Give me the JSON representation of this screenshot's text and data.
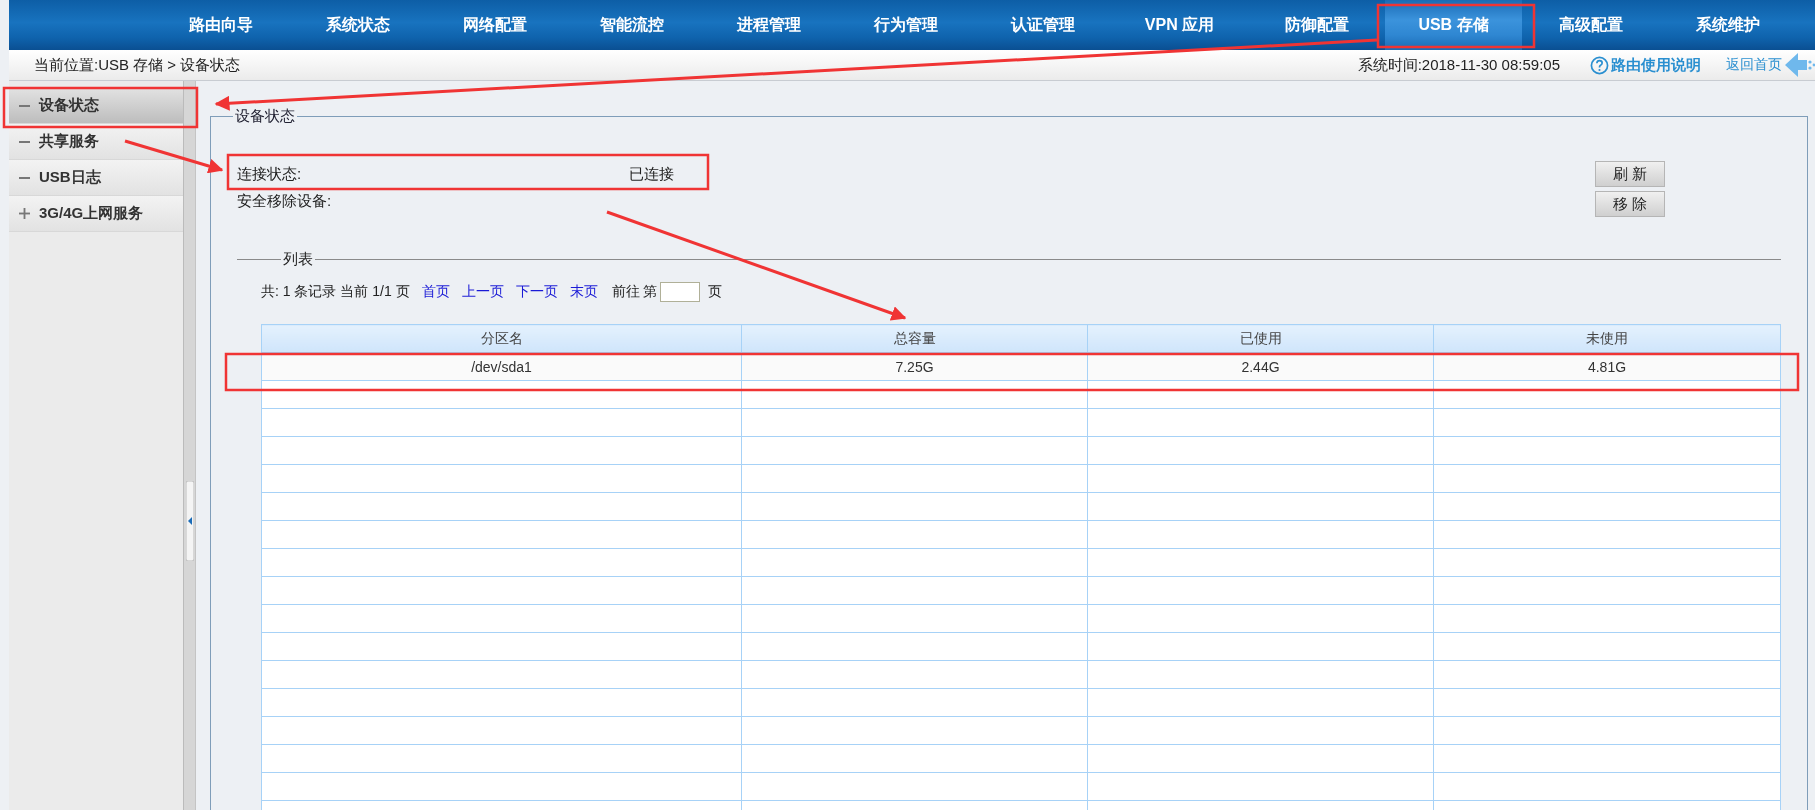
{
  "nav": {
    "items": [
      {
        "label": "路由向导",
        "selected": false
      },
      {
        "label": "系统状态",
        "selected": false
      },
      {
        "label": "网络配置",
        "selected": false
      },
      {
        "label": "智能流控",
        "selected": false
      },
      {
        "label": "进程管理",
        "selected": false
      },
      {
        "label": "行为管理",
        "selected": false
      },
      {
        "label": "认证管理",
        "selected": false
      },
      {
        "label": "VPN 应用",
        "selected": false
      },
      {
        "label": "防御配置",
        "selected": false
      },
      {
        "label": "USB 存储",
        "selected": true
      },
      {
        "label": "高级配置",
        "selected": false
      },
      {
        "label": "系统维护",
        "selected": false
      }
    ]
  },
  "breadcrumb": "当前位置:USB 存储 > 设备状态",
  "system_time": "系统时间:2018-11-30 08:59:05",
  "help_link": "路由使用说明",
  "home_link": "返回首页",
  "sidebar": {
    "items": [
      {
        "label": "设备状态",
        "kind": "leaf",
        "selected": true
      },
      {
        "label": "共享服务",
        "kind": "leaf",
        "selected": false
      },
      {
        "label": "USB日志",
        "kind": "leaf",
        "selected": false
      },
      {
        "label": "3G/4G上网服务",
        "kind": "group",
        "selected": false
      }
    ]
  },
  "device_status": {
    "legend": "设备状态",
    "fields": [
      {
        "label": "连接状态:",
        "value": "已连接"
      },
      {
        "label": "安全移除设备:"
      }
    ],
    "buttons": [
      "刷 新",
      "移 除"
    ]
  },
  "list": {
    "legend": "列表",
    "pager": {
      "summary": "共: 1 条记录 当前 1/1 页",
      "links": [
        "首页",
        "上一页",
        "下一页",
        "末页"
      ],
      "goto_prefix": "前往 第",
      "goto_suffix": "页"
    },
    "table": {
      "columns": [
        "分区名",
        "总容量",
        "已使用",
        "未使用"
      ],
      "rows": [
        [
          "/dev/sda1",
          "7.25G",
          "2.44G",
          "4.81G"
        ]
      ]
    }
  }
}
